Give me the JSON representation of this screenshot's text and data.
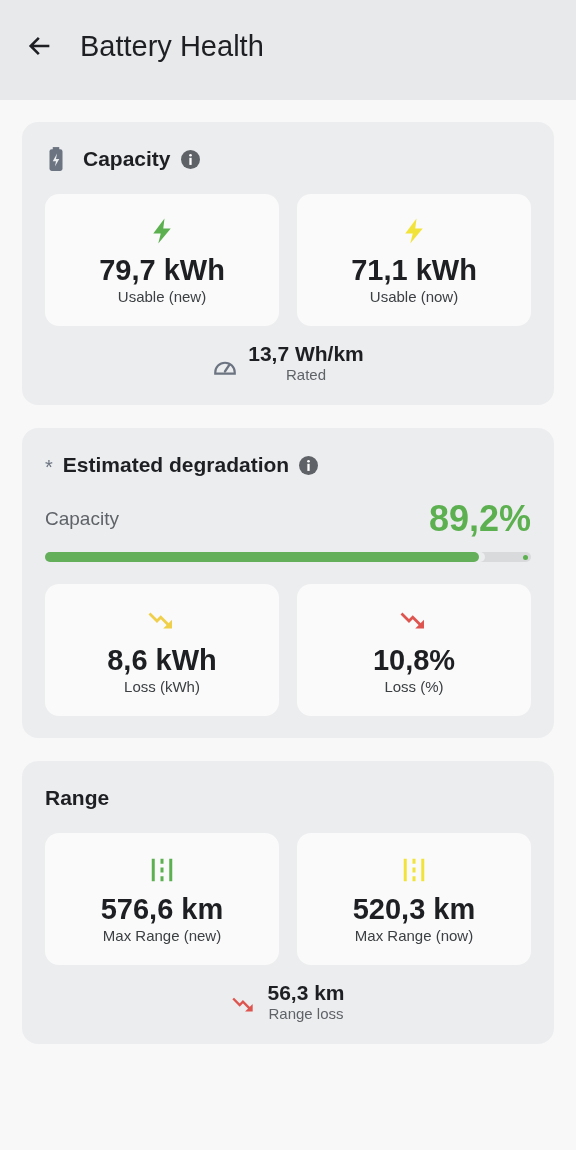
{
  "app_bar": {
    "title": "Battery Health"
  },
  "sections": [
    {
      "kind": "capacity",
      "title": "Capacity",
      "info": true,
      "tiles": [
        {
          "kind": "energy",
          "color": "#5cb04f",
          "value": "79,7 kWh",
          "label": "Usable (new)"
        },
        {
          "kind": "energy",
          "color": "#f2e33a",
          "value": "71,1 kWh",
          "label": "Usable (now)"
        }
      ],
      "footer": {
        "kind": "consumption",
        "color": "#6b7480",
        "value": "13,7 Wh/km",
        "label": "Rated"
      }
    },
    {
      "kind": "degradation",
      "title": "Estimated degradation",
      "marker": "*",
      "info": true,
      "meter": {
        "label": "Capacity",
        "reading": "89,2%",
        "level": 0.892
      },
      "tiles": [
        {
          "kind": "loss",
          "color": "#f0cf4a",
          "value": "8,6 kWh",
          "label": "Loss (kWh)"
        },
        {
          "kind": "loss",
          "color": "#de5550",
          "value": "10,8%",
          "label": "Loss (%)"
        }
      ]
    },
    {
      "kind": "range",
      "title": "Range",
      "info": false,
      "tiles": [
        {
          "kind": "distance",
          "color": "#5cb04f",
          "value": "576,6 km",
          "label": "Max Range (new)"
        },
        {
          "kind": "distance",
          "color": "#f2e33a",
          "value": "520,3 km",
          "label": "Max Range (now)"
        }
      ],
      "footer": {
        "kind": "loss",
        "color": "#de5550",
        "value": "56,3 km",
        "label": "Range loss"
      }
    }
  ]
}
